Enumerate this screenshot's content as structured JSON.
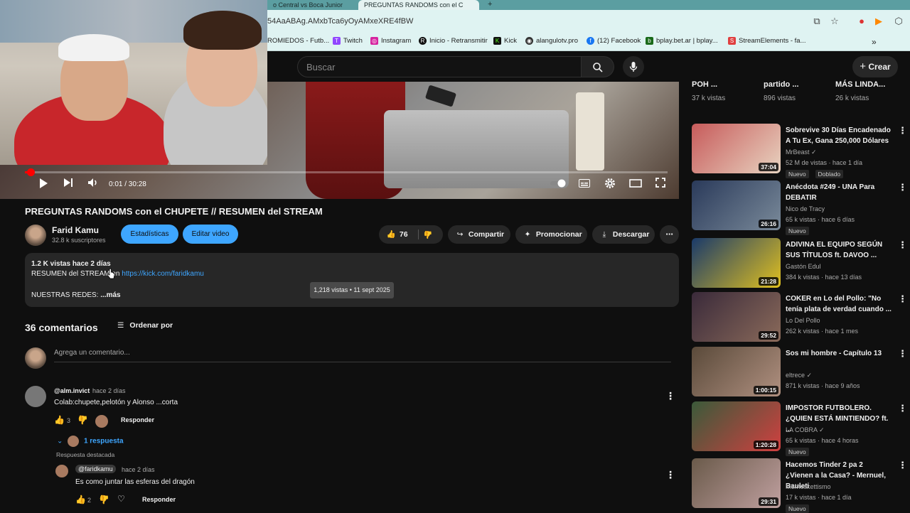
{
  "browser": {
    "tabs": [
      "o Central vs Boca Junior",
      "PREGUNTAS RANDOMS con el C"
    ],
    "new_tab": "+",
    "url": "54AaABAg.AMxbTca6yOyAMxeXRE4fBW",
    "bookmarks": [
      {
        "label": "ROMIEDOS - Futb...",
        "icon": ""
      },
      {
        "label": "Twitch",
        "icon": "T"
      },
      {
        "label": "Instagram",
        "icon": "◎"
      },
      {
        "label": "Inicio - Retransmitir",
        "icon": "R"
      },
      {
        "label": "Kick",
        "icon": "K"
      },
      {
        "label": "alangulotv.pro",
        "icon": "◉"
      },
      {
        "label": "(12) Facebook",
        "icon": "f"
      },
      {
        "label": "bplay.bet.ar | bplay...",
        "icon": "b"
      },
      {
        "label": "StreamElements - fa...",
        "icon": "S"
      }
    ],
    "more_bookmarks": "»"
  },
  "header": {
    "search_placeholder": "Buscar",
    "search_icon": "search-icon",
    "mic_icon": "mic-icon",
    "create_label": "Crear",
    "create_icon": "+"
  },
  "player": {
    "time": "0:01 / 30:28",
    "progress_fraction": 0.0005
  },
  "video": {
    "title": "PREGUNTAS RANDOMS con el CHUPETE // RESUMEN del STREAM",
    "channel": "Farid Kamu",
    "subscribers": "32.8 k suscriptores",
    "btn_stats": "Estadísticas",
    "btn_edit": "Editar video",
    "likes": "76",
    "share": "Compartir",
    "promote": "Promocionar",
    "download": "Descargar",
    "more": "⋯"
  },
  "description": {
    "meta": "1.2 K vistas  hace 2 días",
    "line1": "RESUMEN del STREAM en ",
    "link": "https://kick.com/faridkamu",
    "line3": "NUESTRAS REDES:",
    "more": "...más",
    "tooltip": "1,218 vistas • 11 sept 2025"
  },
  "comments": {
    "count": "36 comentarios",
    "sort": "Ordenar por",
    "add_placeholder": "Agrega un comentario...",
    "items": [
      {
        "author": "@alm.invict",
        "time": "hace 2 días",
        "text": "Colab:chupete,pelotón y Alonso ...corta",
        "likes": "3",
        "reply": "Responder",
        "replies_toggle": "1 respuesta"
      }
    ],
    "highlighted_label": "Respuesta destacada",
    "reply": {
      "author": "@faridkamu",
      "time": "hace 2 días",
      "text": "Es como juntar las esferas del dragón",
      "likes": "2",
      "reply": "Responder"
    }
  },
  "sidebar": {
    "top_cards": [
      {
        "title": "POH ...",
        "views": "37 k vistas"
      },
      {
        "title": "partido ...",
        "views": "896 vistas"
      },
      {
        "title": "MÁS LINDA...",
        "views": "26 k vistas"
      }
    ],
    "recommendations": [
      {
        "title": "Sobrevive 30 Días Encadenado A Tu Ex, Gana 250,000 Dólares",
        "channel": "MrBeast",
        "verified": true,
        "meta": "52 M de vistas · hace 1 día",
        "badges": [
          "Nuevo",
          "Doblado"
        ],
        "duration": "37:04",
        "color1": "#c75b5b",
        "color2": "#e8d3c0"
      },
      {
        "title": "Anécdota #249 - UNA Para DEBATIR",
        "channel": "Nico de Tracy",
        "verified": false,
        "meta": "65 k vistas · hace 6 días",
        "badges": [
          "Nuevo"
        ],
        "duration": "26:16",
        "color1": "#2a3a5a",
        "color2": "#7a8a9a"
      },
      {
        "title": "ADIVINA EL EQUIPO SEGÚN SUS TÍTULOS ft. DAVOO ...",
        "channel": "Gastón Edul",
        "verified": false,
        "meta": "384 k vistas · hace 13 días",
        "badges": [],
        "duration": "21:28",
        "color1": "#1a3a6a",
        "color2": "#e0c020"
      },
      {
        "title": "COKER en Lo del Pollo: \"No tenía plata de verdad cuando ...",
        "channel": "Lo Del Pollo",
        "verified": false,
        "meta": "262 k vistas · hace 1 mes",
        "badges": [],
        "duration": "29:52",
        "color1": "#3a2a3a",
        "color2": "#8a6a5a"
      },
      {
        "title": "Sos mi hombre - Capítulo 13",
        "channel": "eltrece",
        "verified": true,
        "meta": "871 k vistas · hace 9 años",
        "badges": [],
        "duration": "1:00:15",
        "color1": "#5a4a3a",
        "color2": "#b09080"
      },
      {
        "title": "IMPOSTOR FUTBOLERO. ¿QUIEN ESTÁ MINTIENDO? ft. ...",
        "channel": "LA COBRA",
        "verified": true,
        "meta": "65 k vistas · hace 4 horas",
        "badges": [
          "Nuevo"
        ],
        "duration": "1:20:28",
        "color1": "#3a5a3a",
        "color2": "#d04040"
      },
      {
        "title": "Hacemos Tinder 2 pa 2 ¿Vienen a la Casa? - Mernuel, Bauleti",
        "channel": "Mernoskettismo",
        "verified": false,
        "meta": "17 k vistas · hace 1 día",
        "badges": [
          "Nuevo"
        ],
        "duration": "29:31",
        "color1": "#6a5a4a",
        "color2": "#c0a0a0"
      }
    ]
  },
  "colors": {
    "bg": "#0f0f0f",
    "accent_blue": "#3ea6ff",
    "progress_red": "#ff0000",
    "chrome": "#dff3f2"
  }
}
